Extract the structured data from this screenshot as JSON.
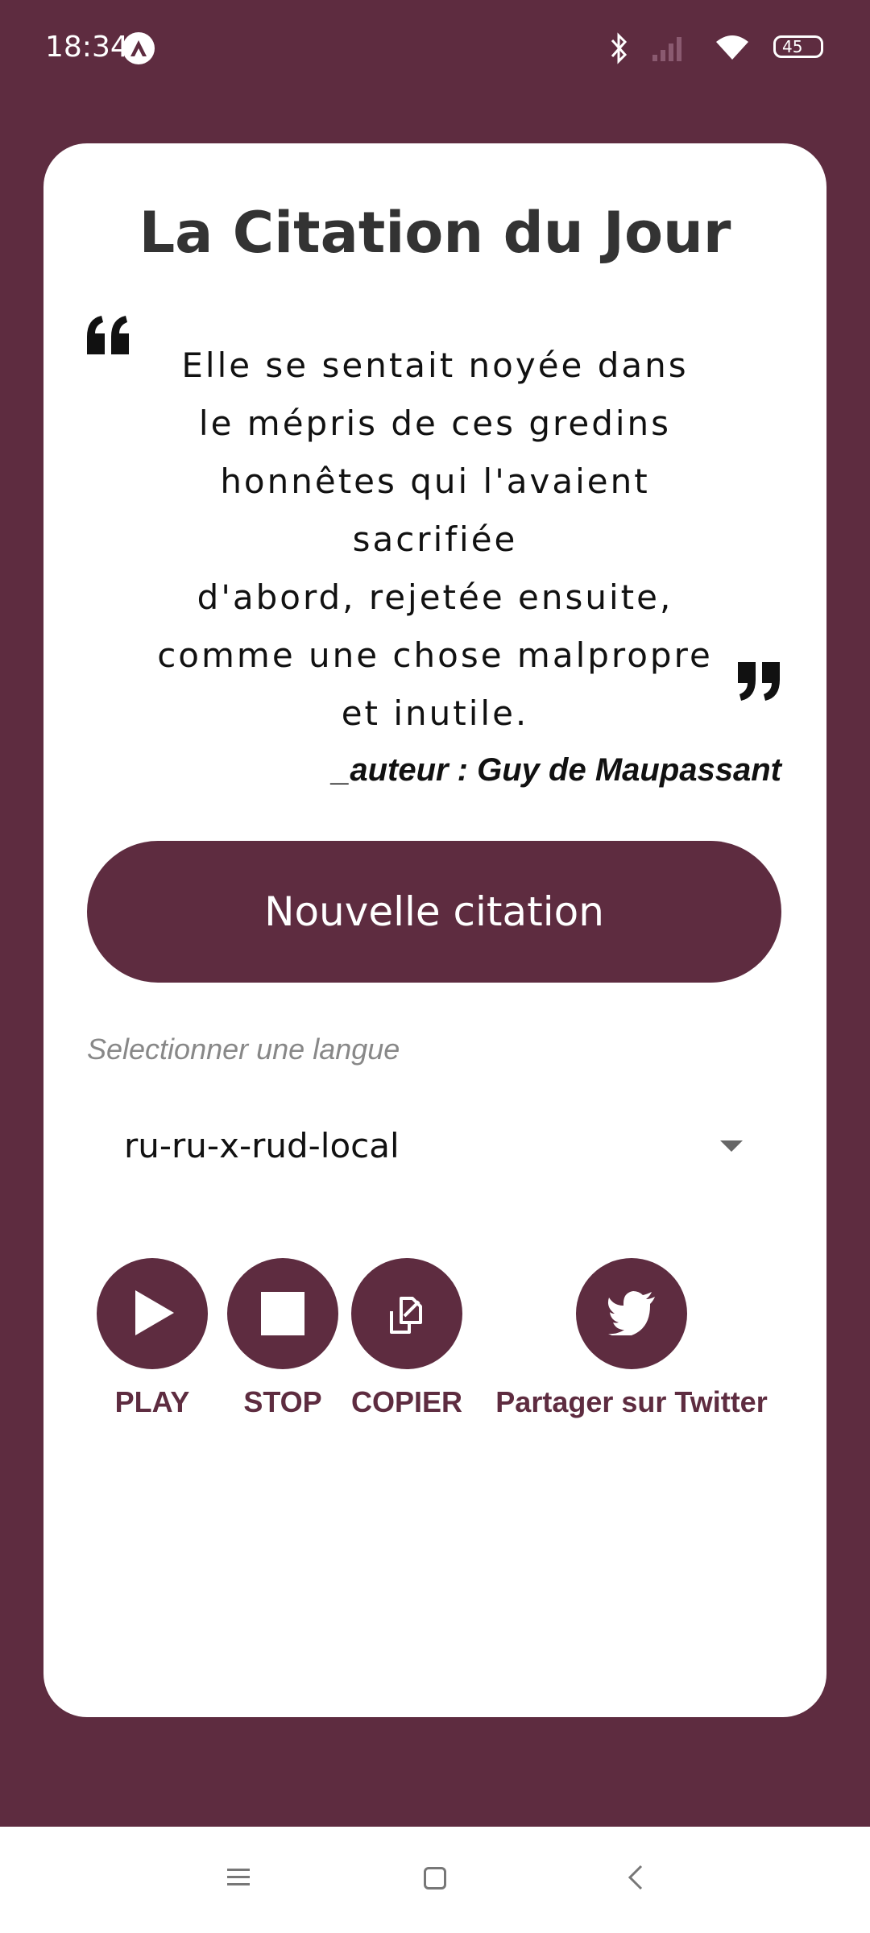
{
  "status_bar": {
    "time": "18:34",
    "battery": "45",
    "icons": [
      "app-notification-icon",
      "bluetooth-icon",
      "signal-icon",
      "wifi-icon",
      "battery-icon"
    ]
  },
  "card": {
    "title": "La Citation du Jour",
    "quote_lines": [
      "Elle se sentait noyée dans",
      "le mépris de ces gredins",
      "honnêtes qui l'avaient sacrifiée",
      "d'abord, rejetée ensuite,",
      "comme une chose malpropre",
      "et inutile."
    ],
    "author": "_auteur : Guy de Maupassant",
    "new_quote_label": "Nouvelle citation",
    "language_label": "Selectionner une langue",
    "language_value": "ru-ru-x-rud-local",
    "actions": [
      {
        "label": "PLAY",
        "icon": "play-icon"
      },
      {
        "label": "STOP",
        "icon": "stop-icon"
      },
      {
        "label": "COPIER",
        "icon": "copy-icon"
      },
      {
        "label": "Partager sur Twitter",
        "icon": "twitter-icon"
      }
    ]
  },
  "nav_bar": {
    "icons": [
      "menu-icon",
      "home-icon",
      "back-icon"
    ]
  },
  "colors": {
    "primary": "#5e2c40",
    "card": "#ffffff",
    "title_text": "#333333",
    "hint_text": "#888888"
  }
}
